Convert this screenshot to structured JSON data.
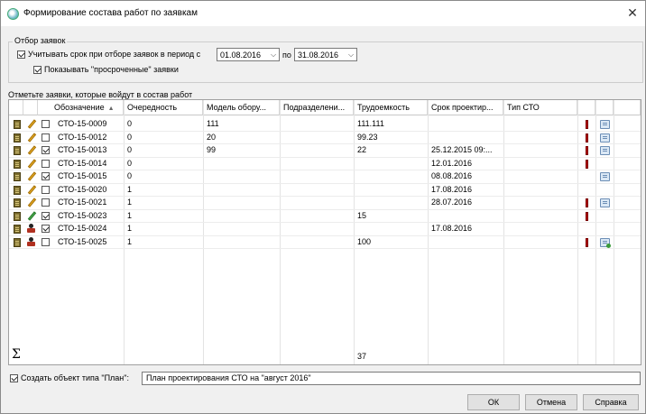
{
  "window": {
    "title": "Формирование состава работ по заявкам",
    "close_glyph": "✕",
    "app_icon": "app-globe-icon"
  },
  "filter": {
    "group_label": "Отбор заявок",
    "period_checkbox_label": "Учитывать срок при отборе заявок в период с",
    "period_checked": true,
    "date_from": "01.08.2016",
    "to_label": "по",
    "date_to": "31.08.2016",
    "overdue_checkbox_label": "Показывать \"просроченные\" заявки",
    "overdue_checked": true
  },
  "list_caption": "Отметьте заявки, которые войдут в состав работ",
  "grid": {
    "columns": [
      "Обозначение",
      "Очередность",
      "Модель обору...",
      "Подразделени...",
      "Трудоемкость",
      "Срок проектир...",
      "Тип СТО"
    ],
    "sort_column_arrow": "▲",
    "rows": [
      {
        "icon_status": "pencil",
        "checked": false,
        "code": "СТО-15-0009",
        "order": "0",
        "model": "111",
        "dept": "",
        "labor": "111.111",
        "deadline": "",
        "type": "",
        "alert": true,
        "doc": "doc"
      },
      {
        "icon_status": "pencil",
        "checked": false,
        "code": "СТО-15-0012",
        "order": "0",
        "model": "20",
        "dept": "",
        "labor": "99.23",
        "deadline": "",
        "type": "",
        "alert": true,
        "doc": "doc"
      },
      {
        "icon_status": "pencil",
        "checked": true,
        "code": "СТО-15-0013",
        "order": "0",
        "model": "99",
        "dept": "",
        "labor": "22",
        "deadline": "25.12.2015 09:...",
        "type": "",
        "alert": true,
        "doc": "doc"
      },
      {
        "icon_status": "pencil",
        "checked": false,
        "code": "СТО-15-0014",
        "order": "0",
        "model": "",
        "dept": "",
        "labor": "",
        "deadline": "12.01.2016",
        "type": "",
        "alert": true,
        "doc": ""
      },
      {
        "icon_status": "pencil",
        "checked": true,
        "code": "СТО-15-0015",
        "order": "0",
        "model": "",
        "dept": "",
        "labor": "",
        "deadline": "08.08.2016",
        "type": "",
        "alert": false,
        "doc": "doc"
      },
      {
        "icon_status": "pencil",
        "checked": false,
        "code": "СТО-15-0020",
        "order": "1",
        "model": "",
        "dept": "",
        "labor": "",
        "deadline": "17.08.2016",
        "type": "",
        "alert": false,
        "doc": ""
      },
      {
        "icon_status": "pencil",
        "checked": false,
        "code": "СТО-15-0021",
        "order": "1",
        "model": "",
        "dept": "",
        "labor": "",
        "deadline": "28.07.2016",
        "type": "",
        "alert": true,
        "doc": "doc-edit"
      },
      {
        "icon_status": "pencil-green",
        "checked": true,
        "code": "СТО-15-0023",
        "order": "1",
        "model": "",
        "dept": "",
        "labor": "15",
        "deadline": "",
        "type": "",
        "alert": true,
        "doc": ""
      },
      {
        "icon_status": "seal",
        "checked": true,
        "code": "СТО-15-0024",
        "order": "1",
        "model": "",
        "dept": "",
        "labor": "",
        "deadline": "17.08.2016",
        "type": "",
        "alert": false,
        "doc": ""
      },
      {
        "icon_status": "seal",
        "checked": false,
        "code": "СТО-15-0025",
        "order": "1",
        "model": "",
        "dept": "",
        "labor": "100",
        "deadline": "",
        "type": "",
        "alert": true,
        "doc": "doc-add"
      }
    ],
    "total_symbol": "Σ",
    "total_labor": "37"
  },
  "plan": {
    "checkbox_label": "Создать объект типа \"План\":",
    "checked": true,
    "value": "План проектирования СТО на \"август 2016\""
  },
  "buttons": {
    "ok": "ОК",
    "cancel": "Отмена",
    "help": "Справка"
  }
}
